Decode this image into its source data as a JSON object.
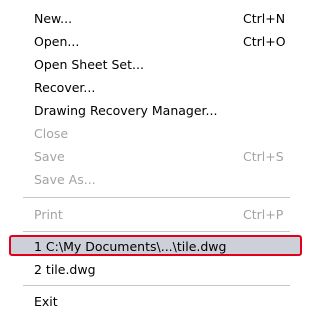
{
  "menu": {
    "items": [
      {
        "label": "New...",
        "shortcut": "Ctrl+N",
        "enabled": true
      },
      {
        "label": "Open...",
        "shortcut": "Ctrl+O",
        "enabled": true
      },
      {
        "label": "Open Sheet Set...",
        "shortcut": "",
        "enabled": true
      },
      {
        "label": "Recover...",
        "shortcut": "",
        "enabled": true
      },
      {
        "label": "Drawing Recovery Manager...",
        "shortcut": "",
        "enabled": true
      },
      {
        "label": "Close",
        "shortcut": "",
        "enabled": false
      },
      {
        "label": "Save",
        "shortcut": "Ctrl+S",
        "enabled": false
      },
      {
        "label": "Save As...",
        "shortcut": "",
        "enabled": false
      },
      {
        "label": "Print",
        "shortcut": "Ctrl+P",
        "enabled": false
      },
      {
        "label": "1 C:\\My Documents\\...\\tile.dwg",
        "shortcut": "",
        "enabled": true,
        "highlighted": true
      },
      {
        "label": "2 tile.dwg",
        "shortcut": "",
        "enabled": true
      },
      {
        "label": "Exit",
        "shortcut": "",
        "enabled": true
      }
    ]
  },
  "colors": {
    "text": "#000000",
    "disabled_text": "#a3a3a3",
    "separator": "#c8c8c8",
    "highlight_border": "#e1001b",
    "highlight_fill": "#cdd0d9"
  }
}
